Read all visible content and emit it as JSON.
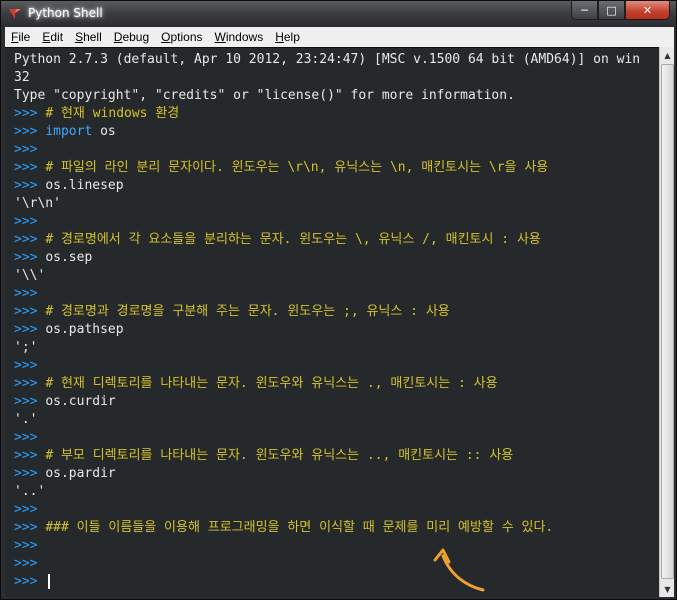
{
  "window": {
    "title": "Python Shell",
    "controls": {
      "minimize": "─",
      "maximize": "□",
      "close": "✕"
    }
  },
  "menu": {
    "items": [
      "File",
      "Edit",
      "Shell",
      "Debug",
      "Options",
      "Windows",
      "Help"
    ]
  },
  "shell": {
    "header_line1": "Python 2.7.3 (default, Apr 10 2012, 23:24:47) [MSC v.1500 64 bit (AMD64)] on win",
    "header_line2": "32",
    "header_line3": "Type \"copyright\", \"credits\" or \"license()\" for more information.",
    "prompt": ">>> ",
    "lines": [
      {
        "type": "comment",
        "text": "# 현재 windows 환경"
      },
      {
        "type": "import",
        "kw": "import",
        "rest": " os"
      },
      {
        "type": "empty"
      },
      {
        "type": "comment",
        "text": "# 파일의 라인 분리 문자이다. 윈도우는 \\r\\n, 유닉스는 \\n, 매킨토시는 \\r을 사용"
      },
      {
        "type": "code",
        "text": "os.linesep"
      },
      {
        "type": "output",
        "text": "'\\r\\n'"
      },
      {
        "type": "empty"
      },
      {
        "type": "comment",
        "text": "# 경로명에서 각 요소들을 분리하는 문자. 윈도우는 \\, 유닉스 /, 매킨토시 : 사용"
      },
      {
        "type": "code",
        "text": "os.sep"
      },
      {
        "type": "output",
        "text": "'\\\\'"
      },
      {
        "type": "empty"
      },
      {
        "type": "comment",
        "text": "# 경로명과 경로명을 구분해 주는 문자. 윈도우는 ;, 유닉스 : 사용"
      },
      {
        "type": "code",
        "text": "os.pathsep"
      },
      {
        "type": "output",
        "text": "';'"
      },
      {
        "type": "empty"
      },
      {
        "type": "comment",
        "text": "# 현재 디렉토리를 나타내는 문자. 윈도우와 유닉스는 ., 매킨토시는 : 사용"
      },
      {
        "type": "code",
        "text": "os.curdir"
      },
      {
        "type": "output",
        "text": "'.'"
      },
      {
        "type": "empty"
      },
      {
        "type": "comment",
        "text": "# 부모 디렉토리를 나타내는 문자. 윈도우와 유닉스는 .., 매킨토시는 :: 사용"
      },
      {
        "type": "code",
        "text": "os.pardir"
      },
      {
        "type": "output",
        "text": "'..'"
      },
      {
        "type": "empty"
      },
      {
        "type": "comment",
        "text": "### 이들 이름들을 이용해 프로그래밍을 하면 이식할 때 문제를 미리 예방할 수 있다."
      },
      {
        "type": "empty"
      },
      {
        "type": "empty"
      },
      {
        "type": "cursor"
      }
    ]
  },
  "colors": {
    "prompt": "#2aa0ff",
    "comment": "#d4c22b",
    "keyword": "#3fa6ff",
    "annotation_arrow": "#f0a030"
  }
}
